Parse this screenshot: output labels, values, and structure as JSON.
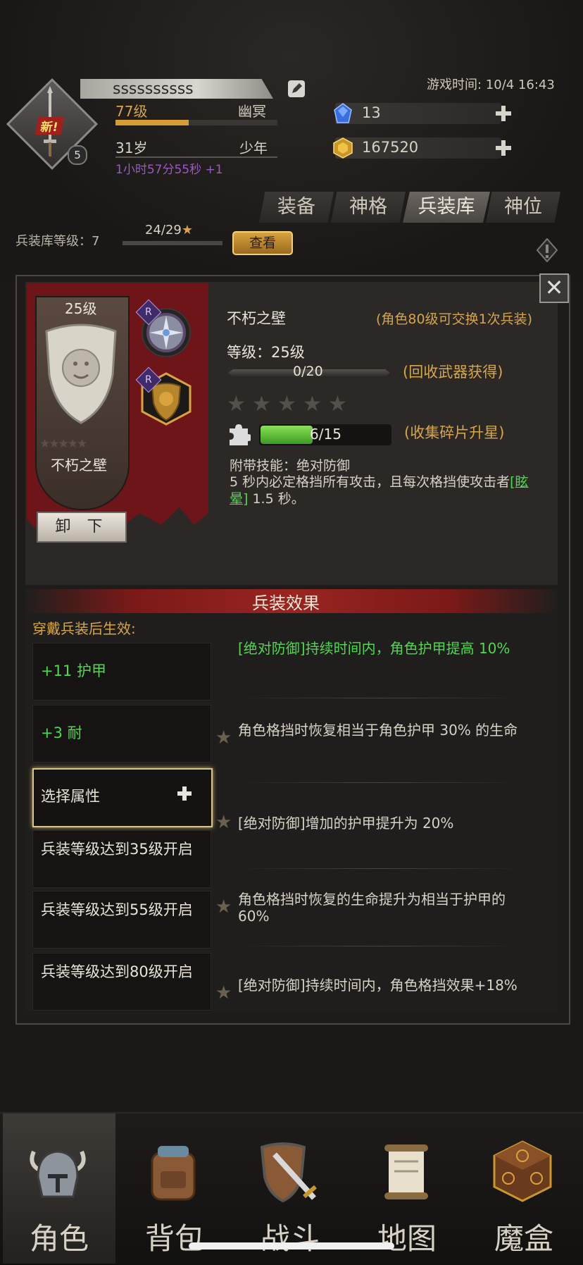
{
  "header": {
    "player_name": "ssssssssss",
    "level_text": "77级",
    "title_text": "幽冥",
    "exp_fraction": 0.45,
    "age_text": "31岁",
    "stage_text": "少年",
    "timer_text": "1小时57分55秒 +1",
    "avatar_badge": "新!",
    "avatar_rank": "5",
    "game_time": "游戏时间: 10/4 16:43",
    "resources": [
      {
        "icon": "blue-crystal-icon",
        "value": "13"
      },
      {
        "icon": "gold-ore-icon",
        "value": "167520"
      }
    ]
  },
  "tabs": [
    {
      "label": "装备",
      "active": false
    },
    {
      "label": "神格",
      "active": false
    },
    {
      "label": "兵装库",
      "active": true
    },
    {
      "label": "神位",
      "active": false
    }
  ],
  "armory": {
    "label": "兵装库等级：7",
    "progress_text": "24/29",
    "star_symbol": "★",
    "view_button": "查看"
  },
  "item": {
    "level_badge": "25级",
    "name": "不朽之壁",
    "unequip_button": "卸 下",
    "rarity_badge": "R",
    "exchange_note": "(角色80级可交换1次兵装)",
    "level_line": "等级：25级",
    "level_progress": "0/20",
    "recycle_note": "(回收武器获得)",
    "stars_filled": 0,
    "stars_total": 5,
    "fragment_progress": "6/15",
    "fragment_fraction": 0.4,
    "collect_note": "(收集碎片升星)",
    "skill_name": "附带技能：绝对防御",
    "skill_desc_before": "5 秒内必定格挡所有攻击，且每次格挡使攻击者",
    "skill_link": "[眩晕]",
    "skill_desc_after": " 1.5 秒。",
    "close_symbol": "✕"
  },
  "effects": {
    "title": "兵装效果",
    "wear_label": "穿戴兵装后生效:",
    "slots": [
      {
        "text": "+11 护甲",
        "style": "green"
      },
      {
        "text": "+3 耐",
        "style": "green"
      },
      {
        "text": "选择属性",
        "style": "select"
      },
      {
        "text": "兵装等级达到35级开启",
        "style": "locked"
      },
      {
        "text": "兵装等级达到55级开启",
        "style": "locked"
      },
      {
        "text": "兵装等级达到80级开启",
        "style": "locked"
      }
    ],
    "list": [
      {
        "text": "[绝对防御]持续时间内，角色护甲提高 10%",
        "green": true
      },
      {
        "text": "角色格挡时恢复相当于角色护甲 30% 的生命",
        "green": false
      },
      {
        "text": "[绝对防御]增加的护甲提升为 20%",
        "green": false
      },
      {
        "text": "角色格挡时恢复的生命提升为相当于护甲的 60%",
        "green": false
      },
      {
        "text": "[绝对防御]持续时间内，角色格挡效果+18%",
        "green": false
      }
    ]
  },
  "nav": [
    {
      "label": "角色",
      "icon": "helmet-icon",
      "active": true
    },
    {
      "label": "背包",
      "icon": "backpack-icon",
      "active": false
    },
    {
      "label": "战斗",
      "icon": "sword-shield-icon",
      "active": false
    },
    {
      "label": "地图",
      "icon": "scroll-map-icon",
      "active": false
    },
    {
      "label": "魔盒",
      "icon": "magic-box-icon",
      "active": false
    }
  ]
}
